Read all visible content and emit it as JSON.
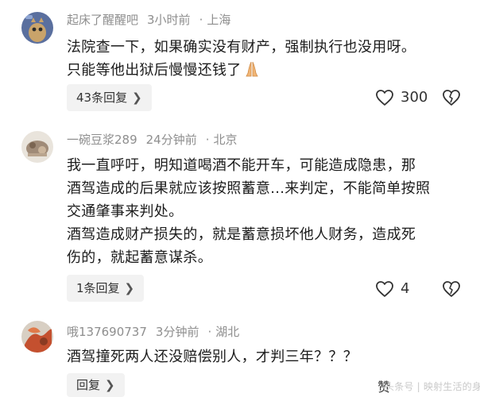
{
  "comments": [
    {
      "username": "起床了醒醒吧",
      "time": "3小时前",
      "separator": "·",
      "location": "上海",
      "lines": [
        "法院查一下，如果确实没有财产，强制执行也没用呀。",
        "只能等他出狱后慢慢还钱了"
      ],
      "emoji": "pray-emoji",
      "reply_label": "43条回复",
      "likes": "300"
    },
    {
      "username": "一碗豆浆289",
      "time": "24分钟前",
      "separator": "·",
      "location": "北京",
      "lines": [
        "我一直呼吁，明知道喝酒不能开车，可能造成隐患，那",
        "酒驾造成的后果就应该按照蓄意...来判定，不能简单按照",
        "交通肇事来判处。",
        "酒驾造成财产损失的，就是蓄意损坏他人财务，造成死",
        "伤的，就起蓄意谋杀。"
      ],
      "reply_label": "1条回复",
      "likes": "4"
    },
    {
      "username": "哦137690737",
      "time": "3分钟前",
      "separator": "·",
      "location": "湖北",
      "lines": [
        "酒驾撞死两人还没赔偿别人，才判三年？？？"
      ],
      "reply_label": "回复",
      "likes": "赞"
    }
  ],
  "icons": {
    "like": "heart-outline-icon",
    "dislike": "broken-heart-icon",
    "chevron": "chevron-right-icon"
  },
  "watermark": "头条号 | 映射生活的身影",
  "colors": {
    "meta": "#8e8e8e",
    "text": "#1c1c1c",
    "pill_bg": "#f2f2f2"
  }
}
